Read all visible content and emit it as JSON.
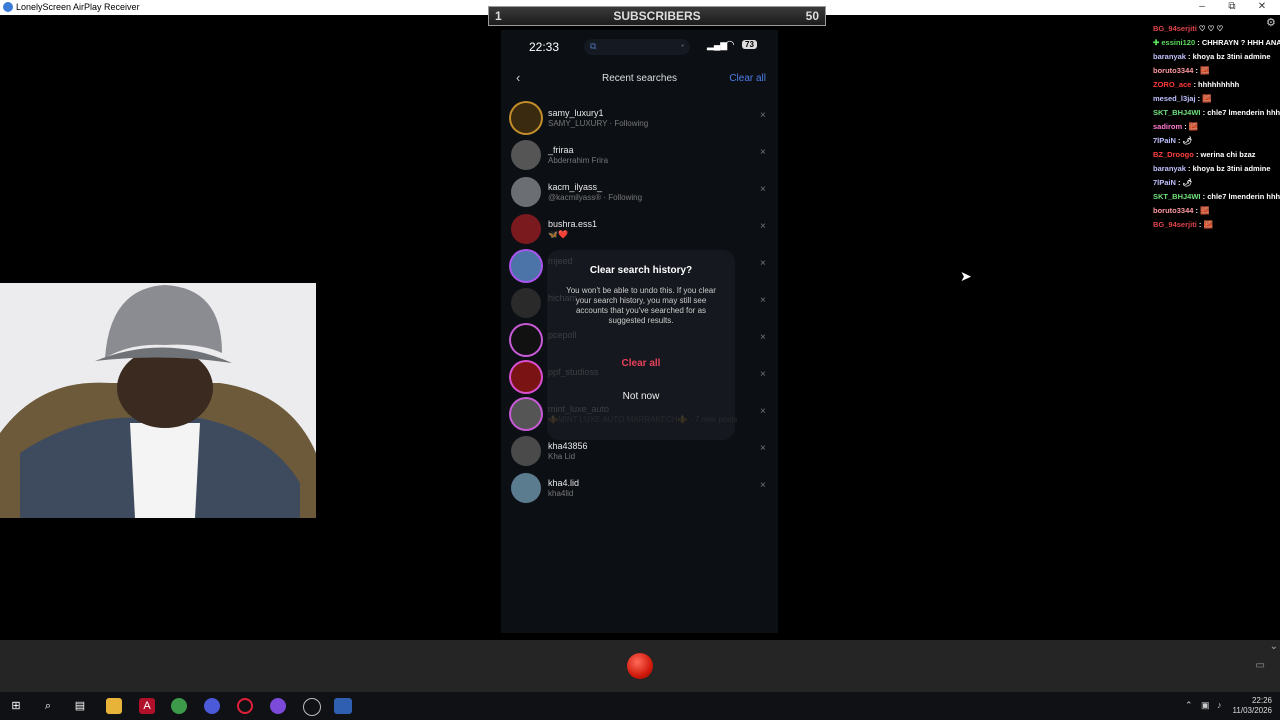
{
  "window": {
    "title": "LonelyScreen AirPlay Receiver",
    "min": "–",
    "restore": "⧉",
    "close": "✕"
  },
  "subscribers": {
    "left": "1",
    "label": "SUBSCRIBERS",
    "right": "50"
  },
  "status": {
    "time": "22:33",
    "battery": "73"
  },
  "header": {
    "title": "Recent searches",
    "clear_all": "Clear all",
    "back_icon": "‹"
  },
  "recent": [
    {
      "name": "samy_luxury1",
      "sub": "SAMY_LUXURY · Following",
      "color": "#3a2b10",
      "ring": "#c38d2a"
    },
    {
      "name": "_friraa",
      "sub": "Abderrahim Frira",
      "color": "#555",
      "ring": ""
    },
    {
      "name": "kacm_ilyass_",
      "sub": "@kacmilyass® · Following",
      "color": "#6b6f73",
      "ring": ""
    },
    {
      "name": "bushra.ess1",
      "sub": "🦋❤️",
      "color": "#7a1a1f",
      "ring": ""
    },
    {
      "name": "mjeed",
      "sub": "",
      "color": "#4d74a8",
      "ring": "#aa55ee"
    },
    {
      "name": "hicham",
      "sub": "",
      "color": "#2a2a2a",
      "ring": ""
    },
    {
      "name": "pcepoll",
      "sub": "",
      "color": "#111",
      "ring": "#c95bd8"
    },
    {
      "name": "ppf_studioss",
      "sub": "",
      "color": "#7a1414",
      "ring": "#d94fd0"
    },
    {
      "name": "mint_luxe_auto",
      "sub": "⚜️MINT LUXE AUTO MARRAKECH⚜️ · 7 new posts",
      "color": "#555",
      "ring": "#c95bd8"
    },
    {
      "name": "kha43856",
      "sub": "Kha Lid",
      "color": "#4a4a4a",
      "ring": ""
    },
    {
      "name": "kha4.lid",
      "sub": "kha4lid",
      "color": "#5b7b8f",
      "ring": ""
    }
  ],
  "remove_icon": "×",
  "modal": {
    "title": "Clear search history?",
    "text": "You won't be able to undo this. If you clear your search history, you may still see accounts that you've searched for as suggested results.",
    "clear": "Clear all",
    "not_now": "Not now"
  },
  "chat": [
    {
      "user": "BG_94serjiti",
      "text": "♡ ♡ ♡",
      "color": "#e0444a"
    },
    {
      "user": "✚ essini120",
      "text": ": CHHRAYN ? HHH ANA HHHHHHHHHHHHHHHHH",
      "color": "#5bdc5b"
    },
    {
      "user": "baranyak",
      "text": ": khoya bz 3tini admine",
      "color": "#c0c0ff"
    },
    {
      "user": "boruto3344",
      "text": ": 🧱",
      "color": "#ff9aa0"
    },
    {
      "user": "ZORO_ace",
      "text": ": hhhhhhhhh",
      "color": "#ff3a3a"
    },
    {
      "user": "mesed_l3jaj",
      "text": ": 🧱",
      "color": "#c0c0ff"
    },
    {
      "user": "SKT_BHJ4WI",
      "text": ": chle7 lmenderin hhh",
      "color": "#6fe07a"
    },
    {
      "user": "sadirom",
      "text": ": 🧱",
      "color": "#ff7ad0"
    },
    {
      "user": "7lPaiN",
      "text": ": 🌶",
      "color": "#c0c0ff"
    },
    {
      "user": "BZ_Droogo",
      "text": ": werina chi bzaz",
      "color": "#ff4040"
    },
    {
      "user": "baranyak",
      "text": ": khoya bz 3tini admine",
      "color": "#c0c0ff"
    },
    {
      "user": "7lPaiN",
      "text": ": 🌶",
      "color": "#c0c0ff"
    },
    {
      "user": "SKT_BHJ4WI",
      "text": ": chle7 lmenderin hhh",
      "color": "#6fe07a"
    },
    {
      "user": "boruto3344",
      "text": ": 🧱",
      "color": "#ff9aa0"
    },
    {
      "user": "BG_94serjiti",
      "text": ": 🧱",
      "color": "#e0444a"
    }
  ],
  "taskbar": {
    "icons": [
      "windows-start",
      "search",
      "task-view",
      "file-explorer",
      "acrobat",
      "chrome",
      "browser",
      "opera",
      "obs",
      "screen-recorder",
      "lonelyscreen"
    ],
    "time": "22:26",
    "date": "11/03/2026"
  }
}
